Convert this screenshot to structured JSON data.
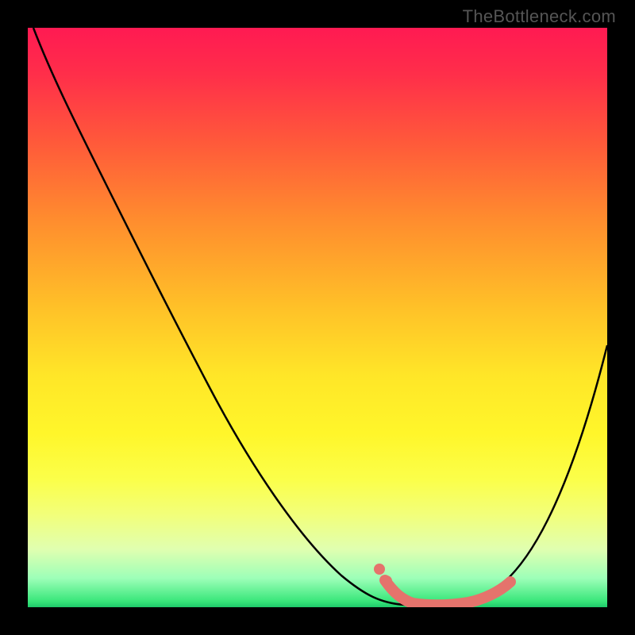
{
  "watermark": "TheBottleneck.com",
  "colors": {
    "curve_main": "#000000",
    "curve_highlight": "#e5736c",
    "frame": "#000000"
  },
  "chart_data": {
    "type": "line",
    "title": "",
    "xlabel": "",
    "ylabel": "",
    "xlim": [
      0,
      100
    ],
    "ylim": [
      0,
      100
    ],
    "grid": false,
    "series": [
      {
        "name": "bottleneck_curve",
        "color": "#000000",
        "x": [
          1,
          3,
          6,
          10,
          14,
          18,
          22,
          26,
          30,
          34,
          38,
          42,
          46,
          50,
          54,
          58,
          62,
          64,
          67,
          70,
          73,
          77,
          82,
          86,
          90,
          94,
          98,
          100
        ],
        "y": [
          100,
          97,
          93,
          88,
          82,
          76,
          69,
          62,
          55,
          48,
          41,
          34,
          27,
          20,
          14,
          9,
          5,
          3,
          1.5,
          1,
          1,
          1.3,
          3,
          7,
          14,
          24,
          37,
          45
        ]
      },
      {
        "name": "highlight_region",
        "color": "#e5736c",
        "x": [
          62,
          64,
          67,
          70,
          73,
          77,
          80,
          82
        ],
        "y": [
          5,
          3,
          1.5,
          1,
          1,
          1.3,
          2,
          3
        ]
      },
      {
        "name": "highlight_dots",
        "color": "#e5736c",
        "type": "scatter",
        "x": [
          62,
          64
        ],
        "y": [
          5,
          3
        ]
      }
    ]
  }
}
